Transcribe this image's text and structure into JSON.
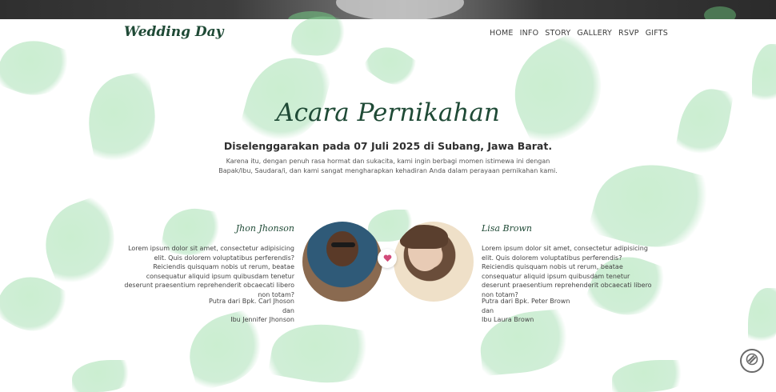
{
  "colors": {
    "accent": "#1f4a36",
    "leaf": "#8fd6a0",
    "heart": "#d24b7a"
  },
  "brand": "Wedding Day",
  "nav": [
    "HOME",
    "INFO",
    "STORY",
    "GALLERY",
    "RSVP",
    "GIFTS"
  ],
  "section": {
    "title": "Acara Pernikahan",
    "subtitle": "Diselenggarakan pada 07 Juli 2025 di Subang, Jawa Barat.",
    "intro": "Karena itu, dengan penuh rasa hormat dan sukacita, kami ingin berbagi momen istimewa ini dengan Bapak/Ibu, Saudara/i, dan kami sangat mengharapkan kehadiran Anda dalam perayaan pernikahan kami."
  },
  "groom": {
    "name": "Jhon Jhonson",
    "desc": "Lorem ipsum dolor sit amet, consectetur adipisicing elit. Quis dolorem voluptatibus perferendis? Reiciendis quisquam nobis ut rerum, beatae consequatur aliquid ipsum quibusdam tenetur deserunt praesentium reprehenderit obcaecati libero non totam?",
    "parents": [
      "Putra dari Bpk. Carl Jhoson",
      "dan",
      "Ibu Jennifer Jhonson"
    ]
  },
  "bride": {
    "name": "Lisa Brown",
    "desc": "Lorem ipsum dolor sit amet, consectetur adipisicing elit. Quis dolorem voluptatibus perferendis? Reiciendis quisquam nobis ut rerum, beatae consequatur aliquid ipsum quibusdam tenetur deserunt praesentium reprehenderit obcaecati libero non totam?",
    "parents": [
      "Putra dari Bpk. Peter Brown",
      "dan",
      "Ibu Laura Brown"
    ]
  },
  "icons": {
    "heart": "heart-icon",
    "float": "music-disc-icon"
  }
}
